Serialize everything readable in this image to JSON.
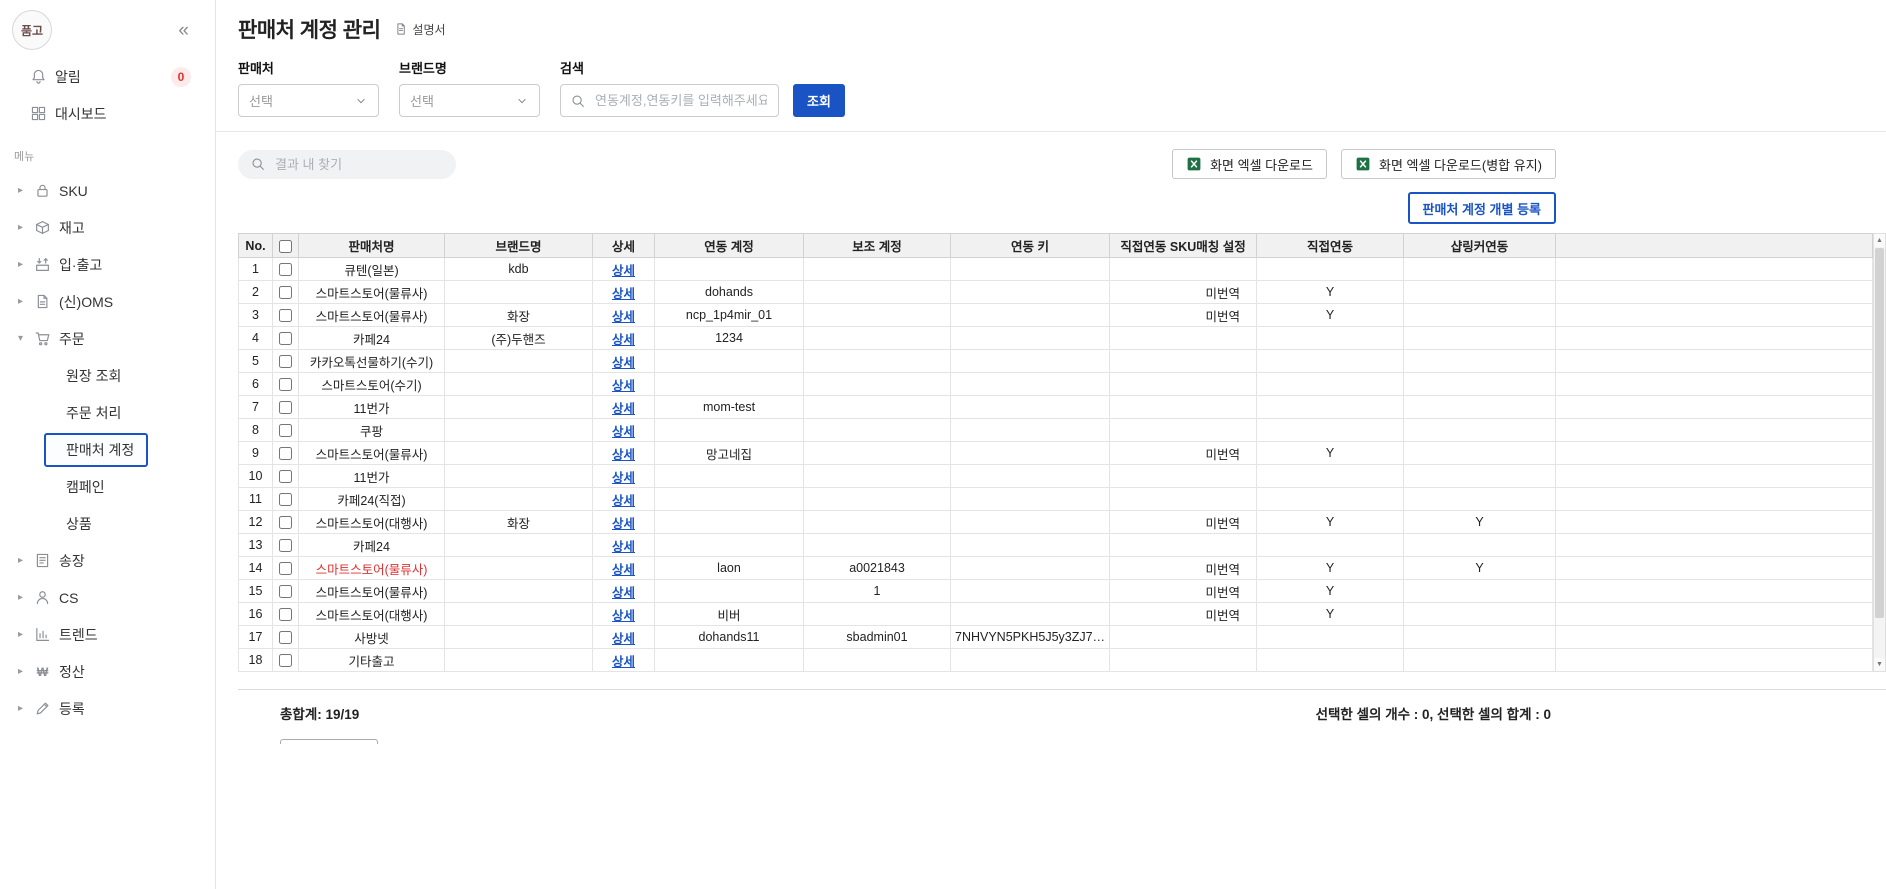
{
  "colors": {
    "accent": "#1a54c4",
    "alert_red": "#e03131",
    "excel_green": "#1e7145"
  },
  "sidebar": {
    "logo": "품고",
    "notifications": {
      "label": "알림",
      "badge": "0"
    },
    "dashboard": {
      "label": "대시보드"
    },
    "menu_label": "메뉴",
    "selected_subitem": "판매처 계정",
    "items": [
      {
        "id": "sku",
        "label": "SKU",
        "icon": "lock",
        "expanded": false
      },
      {
        "id": "inventory",
        "label": "재고",
        "icon": "box",
        "expanded": false
      },
      {
        "id": "inout",
        "label": "입·출고",
        "icon": "inout",
        "expanded": false
      },
      {
        "id": "oms",
        "label": "(신)OMS",
        "icon": "doc-sync",
        "expanded": false
      },
      {
        "id": "orders",
        "label": "주문",
        "icon": "cart",
        "expanded": true,
        "children": [
          "원장 조회",
          "주문 처리",
          "판매처 계정",
          "캠페인",
          "상품"
        ]
      },
      {
        "id": "invoice",
        "label": "송장",
        "icon": "invoice",
        "expanded": false
      },
      {
        "id": "cs",
        "label": "CS",
        "icon": "person",
        "expanded": false
      },
      {
        "id": "trend",
        "label": "트렌드",
        "icon": "chart",
        "expanded": false
      },
      {
        "id": "settlement",
        "label": "정산",
        "icon": "won",
        "expanded": false
      },
      {
        "id": "register",
        "label": "등록",
        "icon": "pencil",
        "expanded": false
      }
    ]
  },
  "header": {
    "title": "판매처 계정 관리",
    "manual_link": "설명서"
  },
  "filters": {
    "seller_label": "판매처",
    "seller_value": "선택",
    "brand_label": "브랜드명",
    "brand_value": "선택",
    "search_label": "검색",
    "search_placeholder": "연동계정,연동키를 입력해주세요",
    "submit_label": "조회"
  },
  "toolbar": {
    "find_placeholder": "결과 내 찾기",
    "excel_download": "화면 엑셀 다운로드",
    "excel_download_merge": "화면 엑셀 다운로드(병합 유지)",
    "register_button": "판매처 계정 개별 등록"
  },
  "table": {
    "columns": [
      "No.",
      "판매처명",
      "브랜드명",
      "상세",
      "연동 계정",
      "보조 계정",
      "연동 키",
      "직접연동 SKU매칭 설정",
      "직접연동",
      "샵링커연동"
    ],
    "detail_label": "상세",
    "rows": [
      {
        "no": "1",
        "seller": "큐텐(일본)",
        "brand": "kdb",
        "account": "",
        "sub_account": "",
        "key": "",
        "sku_match": "",
        "direct": "",
        "shoplinker": "",
        "red": false
      },
      {
        "no": "2",
        "seller": "스마트스토어(물류사)",
        "brand": "",
        "account": "dohands",
        "sub_account": "",
        "key": "",
        "sku_match": "미번역",
        "direct": "Y",
        "shoplinker": "",
        "red": false
      },
      {
        "no": "3",
        "seller": "스마트스토어(물류사)",
        "brand": "화장",
        "account": "ncp_1p4mir_01",
        "sub_account": "",
        "key": "",
        "sku_match": "미번역",
        "direct": "Y",
        "shoplinker": "",
        "red": false
      },
      {
        "no": "4",
        "seller": "카페24",
        "brand": "(주)두핸즈",
        "account": "1234",
        "sub_account": "",
        "key": "",
        "sku_match": "",
        "direct": "",
        "shoplinker": "",
        "red": false
      },
      {
        "no": "5",
        "seller": "카카오톡선물하기(수기)",
        "brand": "",
        "account": "",
        "sub_account": "",
        "key": "",
        "sku_match": "",
        "direct": "",
        "shoplinker": "",
        "red": false
      },
      {
        "no": "6",
        "seller": "스마트스토어(수기)",
        "brand": "",
        "account": "",
        "sub_account": "",
        "key": "",
        "sku_match": "",
        "direct": "",
        "shoplinker": "",
        "red": false
      },
      {
        "no": "7",
        "seller": "11번가",
        "brand": "",
        "account": "mom-test",
        "sub_account": "",
        "key": "",
        "sku_match": "",
        "direct": "",
        "shoplinker": "",
        "red": false
      },
      {
        "no": "8",
        "seller": "쿠팡",
        "brand": "",
        "account": "",
        "sub_account": "",
        "key": "",
        "sku_match": "",
        "direct": "",
        "shoplinker": "",
        "red": false
      },
      {
        "no": "9",
        "seller": "스마트스토어(물류사)",
        "brand": "",
        "account": "망고네집",
        "sub_account": "",
        "key": "",
        "sku_match": "미번역",
        "direct": "Y",
        "shoplinker": "",
        "red": false
      },
      {
        "no": "10",
        "seller": "11번가",
        "brand": "",
        "account": "",
        "sub_account": "",
        "key": "",
        "sku_match": "",
        "direct": "",
        "shoplinker": "",
        "red": false
      },
      {
        "no": "11",
        "seller": "카페24(직접)",
        "brand": "",
        "account": "",
        "sub_account": "",
        "key": "",
        "sku_match": "",
        "direct": "",
        "shoplinker": "",
        "red": false
      },
      {
        "no": "12",
        "seller": "스마트스토어(대행사)",
        "brand": "화장",
        "account": "",
        "sub_account": "",
        "key": "",
        "sku_match": "미번역",
        "direct": "Y",
        "shoplinker": "Y",
        "red": false
      },
      {
        "no": "13",
        "seller": "카페24",
        "brand": "",
        "account": "",
        "sub_account": "",
        "key": "",
        "sku_match": "",
        "direct": "",
        "shoplinker": "",
        "red": false
      },
      {
        "no": "14",
        "seller": "스마트스토어(물류사)",
        "brand": "",
        "account": "laon",
        "sub_account": "a0021843",
        "key": "",
        "sku_match": "미번역",
        "direct": "Y",
        "shoplinker": "Y",
        "red": true
      },
      {
        "no": "15",
        "seller": "스마트스토어(물류사)",
        "brand": "",
        "account": "",
        "sub_account": "1",
        "key": "",
        "sku_match": "미번역",
        "direct": "Y",
        "shoplinker": "",
        "red": false
      },
      {
        "no": "16",
        "seller": "스마트스토어(대행사)",
        "brand": "",
        "account": "비버",
        "sub_account": "",
        "key": "",
        "sku_match": "미번역",
        "direct": "Y",
        "shoplinker": "",
        "red": false
      },
      {
        "no": "17",
        "seller": "사방넷",
        "brand": "",
        "account": "dohands11",
        "sub_account": "sbadmin01",
        "key": "7NHVYN5PKH5J5y3ZJ7…",
        "sku_match": "",
        "direct": "",
        "shoplinker": "",
        "red": false
      },
      {
        "no": "18",
        "seller": "기타출고",
        "brand": "",
        "account": "",
        "sub_account": "",
        "key": "",
        "sku_match": "",
        "direct": "",
        "shoplinker": "",
        "red": false
      }
    ]
  },
  "footer": {
    "total": "총합계: 19/19",
    "selection": "선택한 셀의 개수 : 0, 선택한 셀의 합계 : 0"
  }
}
